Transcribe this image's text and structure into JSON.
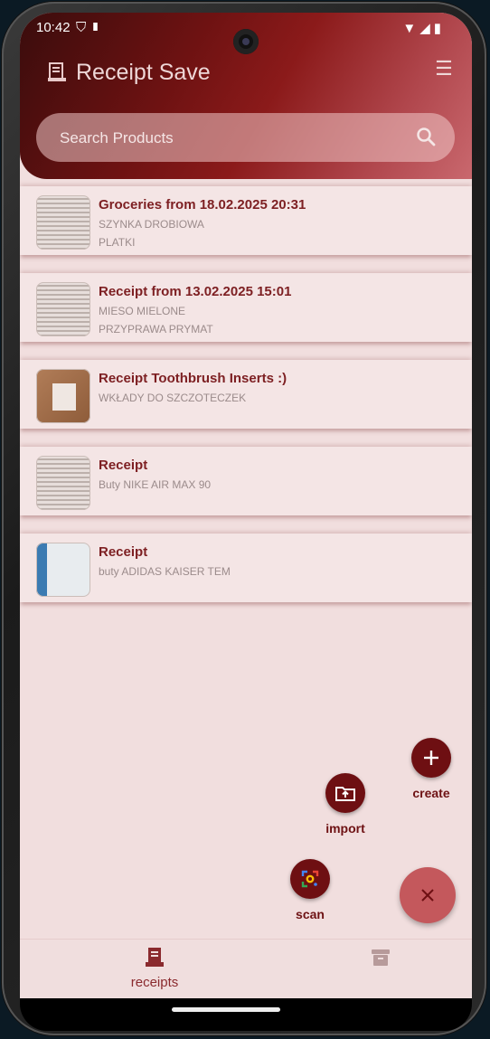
{
  "status_bar": {
    "time": "10:42"
  },
  "app": {
    "title": "Receipt Save"
  },
  "search": {
    "placeholder": "Search Products"
  },
  "receipts": [
    {
      "title": "Groceries from 18.02.2025 20:31",
      "lines": [
        "SZYNKA DROBIOWA",
        "PLATKI"
      ]
    },
    {
      "title": "Receipt from  13.02.2025  15:01",
      "lines": [
        "MIESO MIELONE",
        "PRZYPRAWA PRYMAT"
      ]
    },
    {
      "title": "Receipt Toothbrush Inserts :)",
      "lines": [
        "WKŁADY DO SZCZOTECZEK"
      ]
    },
    {
      "title": "Receipt",
      "lines": [
        "Buty NIKE AIR MAX 90"
      ]
    },
    {
      "title": "Receipt",
      "lines": [
        "buty ADIDAS KAISER TEM"
      ]
    }
  ],
  "fab_actions": {
    "create": "create",
    "import": "import",
    "scan": "scan"
  },
  "bottom_nav": {
    "receipts": "receipts"
  },
  "colors": {
    "primary": "#6e0f12",
    "accent": "#c4585c",
    "background": "#f1dede"
  }
}
